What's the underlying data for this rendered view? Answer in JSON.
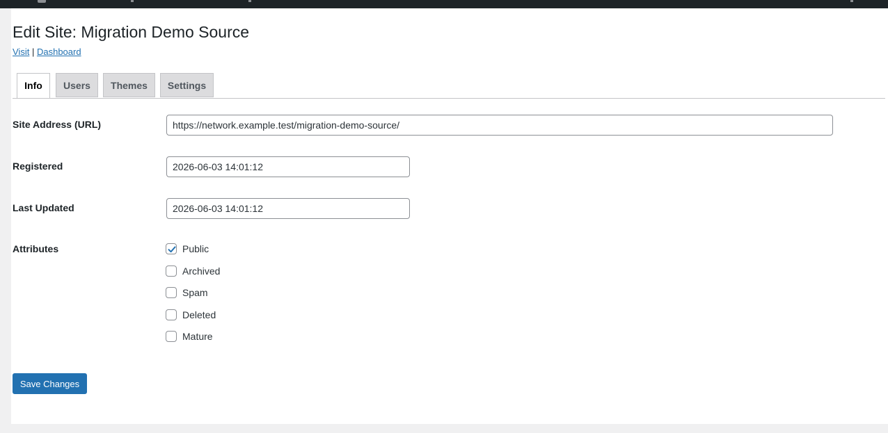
{
  "header": {
    "title": "Edit Site: Migration Demo Source",
    "visit_link": "Visit",
    "separator": "|",
    "dashboard_link": "Dashboard"
  },
  "tabs": [
    {
      "label": "Info",
      "active": true
    },
    {
      "label": "Users",
      "active": false
    },
    {
      "label": "Themes",
      "active": false
    },
    {
      "label": "Settings",
      "active": false
    }
  ],
  "form": {
    "site_address": {
      "label": "Site Address (URL)",
      "value": "https://network.example.test/migration-demo-source/"
    },
    "registered": {
      "label": "Registered",
      "value": "2026-06-03 14:01:12"
    },
    "last_updated": {
      "label": "Last Updated",
      "value": "2026-06-03 14:01:12"
    },
    "attributes": {
      "label": "Attributes",
      "options": [
        {
          "label": "Public",
          "checked": true
        },
        {
          "label": "Archived",
          "checked": false
        },
        {
          "label": "Spam",
          "checked": false
        },
        {
          "label": "Deleted",
          "checked": false
        },
        {
          "label": "Mature",
          "checked": false
        }
      ]
    }
  },
  "save_button": "Save Changes",
  "colors": {
    "accent": "#2271b1",
    "admin_bar": "#1d2327"
  }
}
